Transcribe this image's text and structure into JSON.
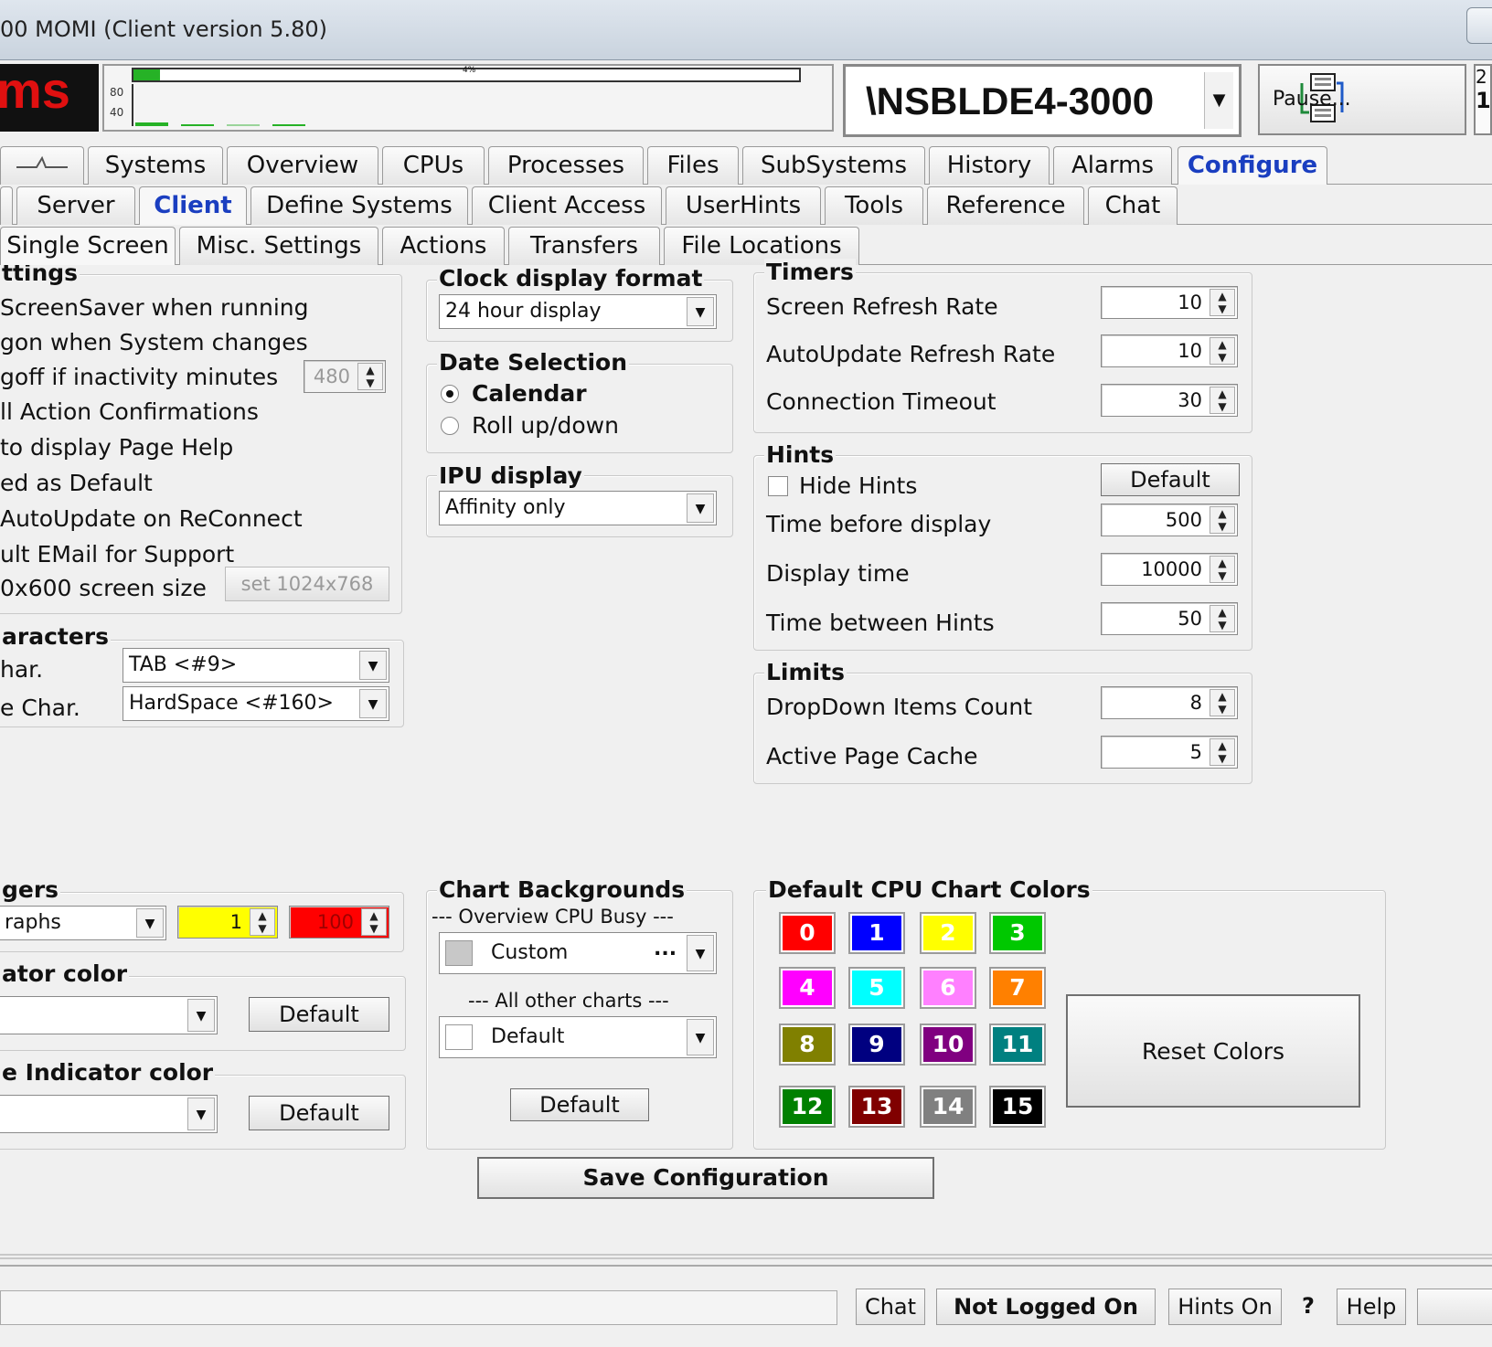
{
  "window": {
    "title": "00 MOMI (Client version 5.80)"
  },
  "header": {
    "logo_text": "ms",
    "monitor": {
      "percent_label": "4%",
      "ytick_80": "80",
      "ytick_40": "40",
      "busy_fraction": 0.04
    },
    "system": {
      "name": "\\NSBLDE4-3000"
    },
    "pause_label": "Pause...",
    "right_digits": [
      "2",
      "1"
    ]
  },
  "tabs": {
    "row1": [
      "Systems",
      "Overview",
      "CPUs",
      "Processes",
      "Files",
      "SubSystems",
      "History",
      "Alarms",
      "Configure"
    ],
    "row1_active": "Configure",
    "row2": [
      "Server",
      "Client",
      "Define Systems",
      "Client Access",
      "UserHints",
      "Tools",
      "Reference",
      "Chat"
    ],
    "row2_active": "Client",
    "row3": [
      "Single Screen",
      "Misc. Settings",
      "Actions",
      "Transfers",
      "File Locations"
    ]
  },
  "settings": {
    "title": "ttings",
    "items": [
      "ScreenSaver when running",
      "gon when System changes",
      "goff if inactivity minutes",
      "ll Action Confirmations",
      "to display Page Help",
      "ed as Default",
      "AutoUpdate on ReConnect",
      "ult EMail for Support",
      "0x600 screen size"
    ],
    "inactivity_value": "480",
    "set_size_button": "set 1024x768"
  },
  "characters": {
    "title": "aracters",
    "row1_label": "har.",
    "row1_value": "TAB <#9>",
    "row2_label": "e Char.",
    "row2_value": "HardSpace <#160>"
  },
  "clock": {
    "title": "Clock display format",
    "value": "24 hour display"
  },
  "date_selection": {
    "title": "Date Selection",
    "options": [
      "Calendar",
      "Roll up/down"
    ],
    "selected": "Calendar"
  },
  "ipu": {
    "title": "IPU display",
    "value": "Affinity only"
  },
  "timers": {
    "title": "Timers",
    "rows": [
      {
        "label": "Screen Refresh Rate",
        "value": "10"
      },
      {
        "label": "AutoUpdate Refresh Rate",
        "value": "10"
      },
      {
        "label": "Connection Timeout",
        "value": "30"
      }
    ]
  },
  "hints": {
    "title": "Hints",
    "hide_label": "Hide Hints",
    "default_button": "Default",
    "rows": [
      {
        "label": "Time before display",
        "value": "500"
      },
      {
        "label": "Display time",
        "value": "10000"
      },
      {
        "label": "Time between Hints",
        "value": "50"
      }
    ]
  },
  "limits": {
    "title": "Limits",
    "rows": [
      {
        "label": "DropDown Items Count",
        "value": "8"
      },
      {
        "label": "Active Page Cache",
        "value": "5"
      }
    ]
  },
  "triggers": {
    "title": "gers",
    "combo_value": "raphs",
    "warn_value": "1",
    "crit_value": "100",
    "warn_color": "#ffff00",
    "crit_color": "#ff0000"
  },
  "indicator_color": {
    "title": "ator color",
    "default_button": "Default"
  },
  "line_indicator_color": {
    "title": "e Indicator color",
    "default_button": "Default"
  },
  "chart_backgrounds": {
    "title": "Chart Backgrounds",
    "overview_label": "--- Overview CPU Busy ---",
    "overview_value": "Custom",
    "overview_ellipsis": "...",
    "other_label": "--- All other charts ---",
    "other_value": "Default",
    "default_button": "Default"
  },
  "cpu_colors": {
    "title": "Default CPU Chart Colors",
    "swatches": [
      {
        "label": "0",
        "color": "#ff0000"
      },
      {
        "label": "1",
        "color": "#0000ff"
      },
      {
        "label": "2",
        "color": "#ffff00"
      },
      {
        "label": "3",
        "color": "#00c800"
      },
      {
        "label": "4",
        "color": "#ff00ff"
      },
      {
        "label": "5",
        "color": "#00ffff"
      },
      {
        "label": "6",
        "color": "#ff80ff"
      },
      {
        "label": "7",
        "color": "#ff8000"
      },
      {
        "label": "8",
        "color": "#808000"
      },
      {
        "label": "9",
        "color": "#000080"
      },
      {
        "label": "10",
        "color": "#800080"
      },
      {
        "label": "11",
        "color": "#008080"
      },
      {
        "label": "12",
        "color": "#008000"
      },
      {
        "label": "13",
        "color": "#800000"
      },
      {
        "label": "14",
        "color": "#808080"
      },
      {
        "label": "15",
        "color": "#000000"
      }
    ],
    "reset_button": "Reset Colors"
  },
  "save_button": "Save Configuration",
  "statusbar": {
    "chat": "Chat",
    "login": "Not Logged On",
    "hints": "Hints On",
    "question": "?",
    "help": "Help"
  }
}
